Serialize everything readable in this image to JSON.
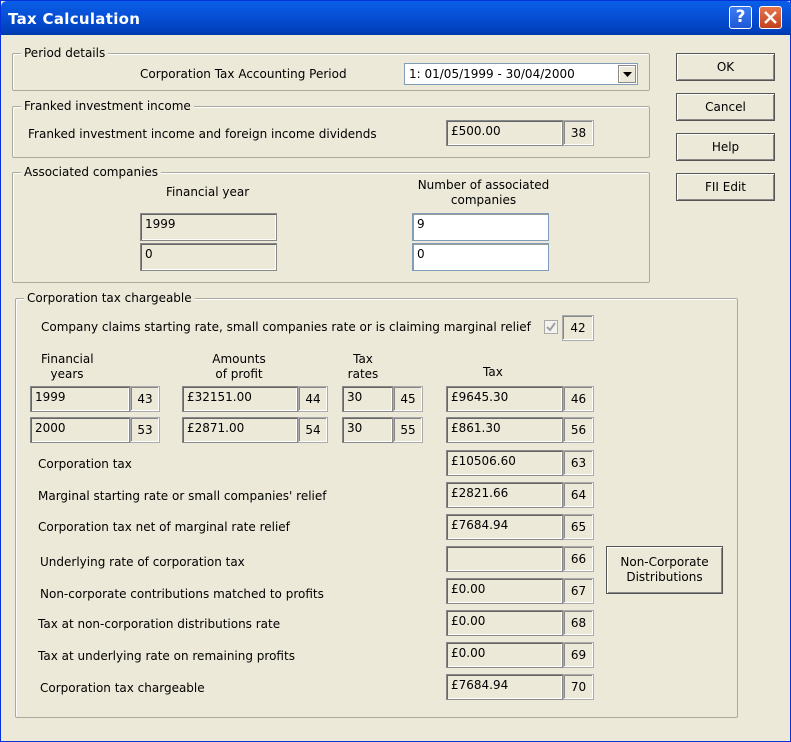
{
  "window": {
    "title": "Tax Calculation"
  },
  "buttons": {
    "ok": "OK",
    "cancel": "Cancel",
    "help": "Help",
    "fii_edit": "FII Edit",
    "non_corporate": "Non-Corporate Distributions"
  },
  "period": {
    "legend": "Period details",
    "label": "Corporation Tax Accounting Period",
    "selected": "1: 01/05/1999 - 30/04/2000"
  },
  "franked": {
    "legend": "Franked investment income",
    "label": "Franked investment income and foreign income dividends",
    "value": "£500.00",
    "box": "38"
  },
  "associated": {
    "legend": "Associated companies",
    "col_year": "Financial year",
    "col_num": "Number of associated companies",
    "rows": [
      {
        "year": "1999",
        "num": "9"
      },
      {
        "year": "0",
        "num": "0"
      }
    ]
  },
  "ctc": {
    "legend": "Corporation tax chargeable",
    "claims_label": "Company claims starting rate, small companies rate or is claiming marginal relief",
    "claims_checked": true,
    "claims_box": "42",
    "headers": {
      "years": "Financial years",
      "profit": "Amounts of profit",
      "rates": "Tax rates",
      "tax": "Tax"
    },
    "rows": [
      {
        "year": "1999",
        "year_box": "43",
        "profit": "£32151.00",
        "profit_box": "44",
        "rate": "30",
        "rate_box": "45",
        "tax": "£9645.30",
        "tax_box": "46"
      },
      {
        "year": "2000",
        "year_box": "53",
        "profit": "£2871.00",
        "profit_box": "54",
        "rate": "30",
        "rate_box": "55",
        "tax": "£861.30",
        "tax_box": "56"
      }
    ],
    "lines": [
      {
        "label": "Corporation tax",
        "value": "£10506.60",
        "box": "63"
      },
      {
        "label": "Marginal starting rate or small companies' relief",
        "value": "£2821.66",
        "box": "64"
      },
      {
        "label": "Corporation tax net of marginal rate relief",
        "value": "£7684.94",
        "box": "65"
      },
      {
        "label": "Underlying rate of corporation tax",
        "value": "",
        "box": "66"
      },
      {
        "label": "Non-corporate contributions matched to profits",
        "value": "£0.00",
        "box": "67"
      },
      {
        "label": "Tax at non-corporation distributions rate",
        "value": "£0.00",
        "box": "68"
      },
      {
        "label": "Tax at underlying rate on remaining profits",
        "value": "£0.00",
        "box": "69"
      },
      {
        "label": "Corporation tax chargeable",
        "value": "£7684.94",
        "box": "70"
      }
    ]
  }
}
